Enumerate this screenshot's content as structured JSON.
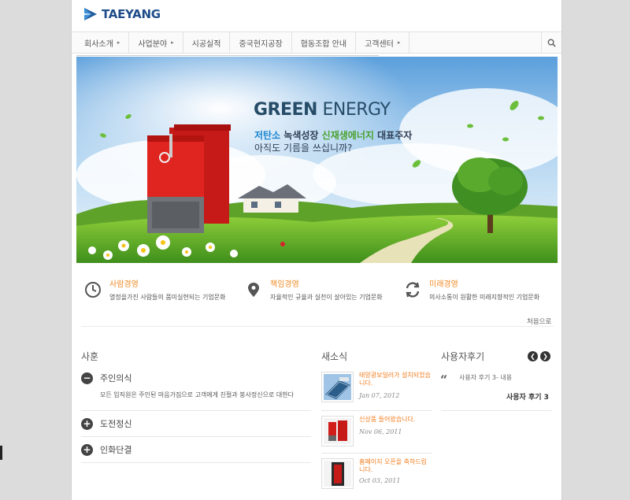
{
  "brand": {
    "name": "TAEYANG"
  },
  "nav": {
    "items": [
      {
        "label": "회사소개",
        "caret": "▸"
      },
      {
        "label": "사업분야",
        "caret": "▸"
      },
      {
        "label": "시공실적",
        "caret": ""
      },
      {
        "label": "중국현지공장",
        "caret": ""
      },
      {
        "label": "협동조합 안내",
        "caret": ""
      },
      {
        "label": "고객센터",
        "caret": "▸"
      }
    ],
    "search_icon": "search-icon"
  },
  "hero": {
    "title_bold": "GREEN",
    "title_rest": " ENERGY",
    "line1_a": "저탄소",
    "line1_b": " 녹색성장 ",
    "line1_c": "신재생에너지",
    "line1_d": " 대표주자",
    "line2": "아직도 기름을 쓰십니까?"
  },
  "values": [
    {
      "title": "사람경영",
      "desc": "열정을가진 사람들의 품미실현되는 기업문화",
      "icon": "clock-icon"
    },
    {
      "title": "책임경영",
      "desc": "자율적인 규율과 실천이 살아있는 기업문화",
      "icon": "map-pin-icon"
    },
    {
      "title": "미래경영",
      "desc": "의사소통이 원활한 미래지향적인 기업문화",
      "icon": "refresh-icon"
    }
  ],
  "back_link": "처음으로",
  "motto": {
    "title": "사훈",
    "items": [
      {
        "label": "주인의식",
        "state": "−"
      },
      {
        "label": "도전정신",
        "state": "+"
      },
      {
        "label": "인화단결",
        "state": "+"
      }
    ],
    "expanded_text": "모든 임직원은 주인된 마음가짐으로 고객에게 친절과 봉사정신으로 대한다"
  },
  "news": {
    "title": "새소식",
    "items": [
      {
        "title": "태양광보일러가 설치되었습니다.",
        "date": "Jan 07, 2012"
      },
      {
        "title": "신상품 들어왔습니다.",
        "date": "Nov 06, 2011"
      },
      {
        "title": "홈페이지 오픈을 축하드립니다.",
        "date": "Oct 03, 2011"
      }
    ]
  },
  "reviews": {
    "title": "사용자후기",
    "prev": "❮",
    "next": "❯",
    "quote_mark": "“",
    "text": "사용자 후기 3- 내용",
    "author": "사용자 후기 3"
  },
  "colors": {
    "accent": "#f08a24",
    "brand": "#1f4d8a",
    "boiler": "#d3201e"
  }
}
